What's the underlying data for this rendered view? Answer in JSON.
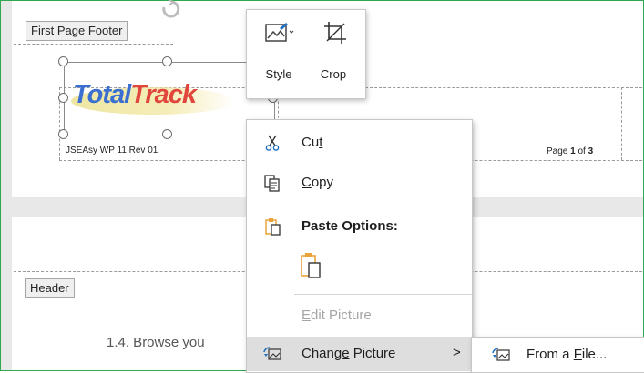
{
  "document": {
    "first_footer_tag": "First Page Footer",
    "logo_total": "Total",
    "logo_track": "Track",
    "footer_left_text": "JSEAsy WP 11 Rev 01",
    "page_label_pre": "Page ",
    "page_current": "1",
    "page_label_mid": " of ",
    "page_total": "3",
    "header_tag": "Header",
    "body_text": "1.4.  Browse you"
  },
  "picture_toolbar": {
    "style_label": "Style",
    "crop_label": "Crop"
  },
  "context_menu": {
    "cut": {
      "pre": "Cu",
      "accel": "t",
      "post": ""
    },
    "copy": {
      "pre": "",
      "accel": "C",
      "post": "opy"
    },
    "paste_options": "Paste Options:",
    "edit_picture": {
      "pre": "",
      "accel": "E",
      "post": "dit Picture"
    },
    "change_picture": {
      "pre": "Chang",
      "accel": "e",
      "post": " Picture"
    },
    "submenu_arrow": ">"
  },
  "submenu": {
    "from_file": {
      "pre": "From a ",
      "accel": "F",
      "post": "ile..."
    }
  },
  "colors": {
    "frame_border": "#2fa84f",
    "logo_blue": "#3a6fd1",
    "logo_red": "#e0463b",
    "highlight": "#dedede",
    "icon_blue": "#1f6fbf",
    "icon_orange": "#e8a33a"
  },
  "icons": [
    "style-icon",
    "crop-icon",
    "scissors-icon",
    "copy-icon",
    "paste-options-icon",
    "paste-keep-icon",
    "change-picture-icon",
    "from-file-icon",
    "rotate-handle-icon"
  ]
}
